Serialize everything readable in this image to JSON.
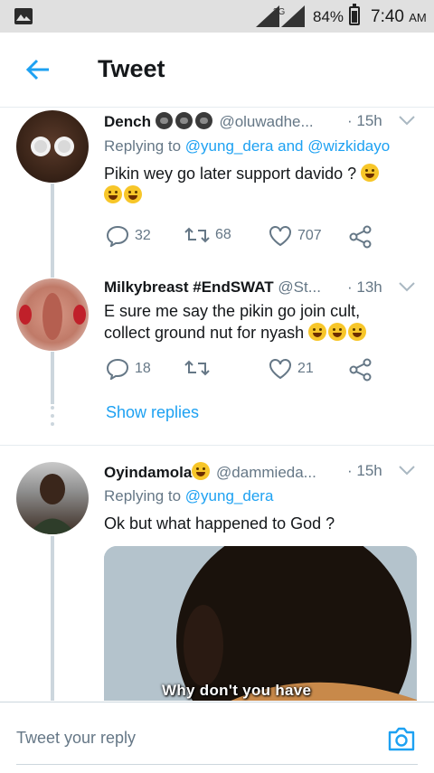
{
  "status_bar": {
    "network": "3G",
    "battery": "84%",
    "battery_level": 0.84,
    "time": "7:40",
    "time_suffix": "AM"
  },
  "header": {
    "title": "Tweet",
    "back_icon": "arrow-left-icon"
  },
  "tweets": [
    {
      "name": "Dench",
      "name_emoji": [
        "gorilla",
        "gorilla",
        "gorilla"
      ],
      "handle": "@oluwadhe...",
      "time": "· 15h",
      "replying_prefix": "Replying to",
      "replying_to_1": "@yung_dera",
      "replying_and": "and",
      "replying_to_2": "@wizkidayo",
      "text": "Pikin wey go later support davido ?",
      "replies": "32",
      "retweets": "68",
      "likes": "707"
    },
    {
      "name": "Milkybreast #EndSWAT",
      "handle": "@St...",
      "time": "· 13h",
      "text_line1": "E sure me say the pikin go join cult,",
      "text_line2": "collect ground nut for nyash",
      "replies": "18",
      "retweets": "",
      "likes": "21",
      "show_replies": "Show replies"
    },
    {
      "name": "Oyindamola",
      "handle": "@dammieda...",
      "time": "· 15h",
      "replying_prefix": "Replying to",
      "replying_to_1": "@yung_dera",
      "text": "Ok but what happened to God ?",
      "media_caption": "Why don't you have"
    }
  ],
  "compose": {
    "placeholder": "Tweet your reply",
    "camera_icon": "camera-icon"
  },
  "colors": {
    "accent": "#1da1f2",
    "secondary_text": "#657786",
    "primary_text": "#14171a",
    "status_bar_bg": "#e0e0e0"
  }
}
